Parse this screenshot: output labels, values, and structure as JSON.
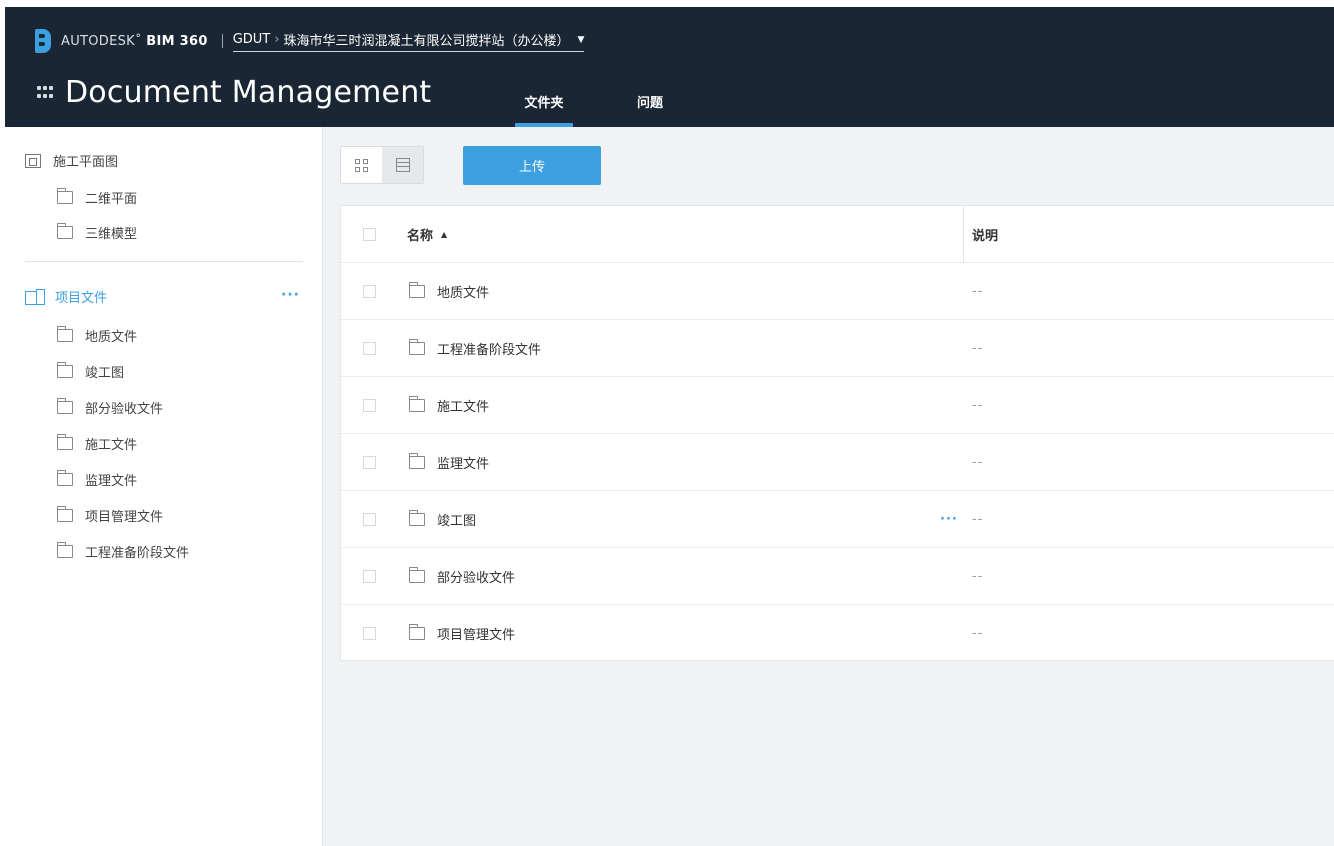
{
  "header": {
    "brand_prefix": "AUTODESK",
    "brand_product": "BIM 360",
    "brand_mark": "˚",
    "breadcrumb_account": "GDUT",
    "breadcrumb_sep": "›",
    "breadcrumb_project": "珠海市华三时润混凝土有限公司搅拌站（办公楼）",
    "app_title": "Document Management",
    "tabs": [
      {
        "label": "文件夹",
        "active": true
      },
      {
        "label": "问题",
        "active": false
      }
    ]
  },
  "sidebar": {
    "plans_root": "施工平面图",
    "plans_children": [
      "二维平面",
      "三维模型"
    ],
    "project_root": "项目文件",
    "project_root_more": "···",
    "project_children": [
      "地质文件",
      "竣工图",
      "部分验收文件",
      "施工文件",
      "监理文件",
      "项目管理文件",
      "工程准备阶段文件"
    ]
  },
  "toolbar": {
    "upload_label": "上传"
  },
  "table": {
    "columns": {
      "name": "名称",
      "name_sort": "▲",
      "description": "说明"
    },
    "rows": [
      {
        "name": "地质文件",
        "description": "--"
      },
      {
        "name": "工程准备阶段文件",
        "description": "--"
      },
      {
        "name": "施工文件",
        "description": "--"
      },
      {
        "name": "监理文件",
        "description": "--"
      },
      {
        "name": "竣工图",
        "description": "--",
        "more": "···"
      },
      {
        "name": "部分验收文件",
        "description": "--"
      },
      {
        "name": "项目管理文件",
        "description": "--"
      }
    ]
  },
  "colors": {
    "header_bg": "#1a2633",
    "accent": "#3b9fe0",
    "main_bg": "#f0f2f4"
  }
}
